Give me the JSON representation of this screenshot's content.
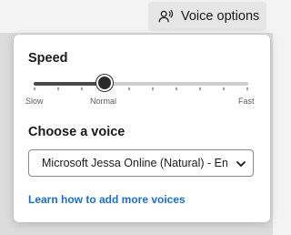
{
  "header": {
    "voice_options_label": "Voice options",
    "voice_options_icon": "voice-speaker-icon"
  },
  "panel": {
    "speed": {
      "title": "Speed",
      "min_label": "Slow",
      "mid_label": "Normal",
      "max_label": "Fast",
      "value_fraction": 0.33
    },
    "voice": {
      "title": "Choose a voice",
      "selected": "Microsoft Jessa Online (Natural) - English"
    },
    "learn_more": "Learn how to add more voices"
  },
  "colors": {
    "link": "#1a6fc9",
    "thumb": "#2b2b2b",
    "track_fill": "#4a4a4a",
    "track": "#cfcfcf"
  }
}
